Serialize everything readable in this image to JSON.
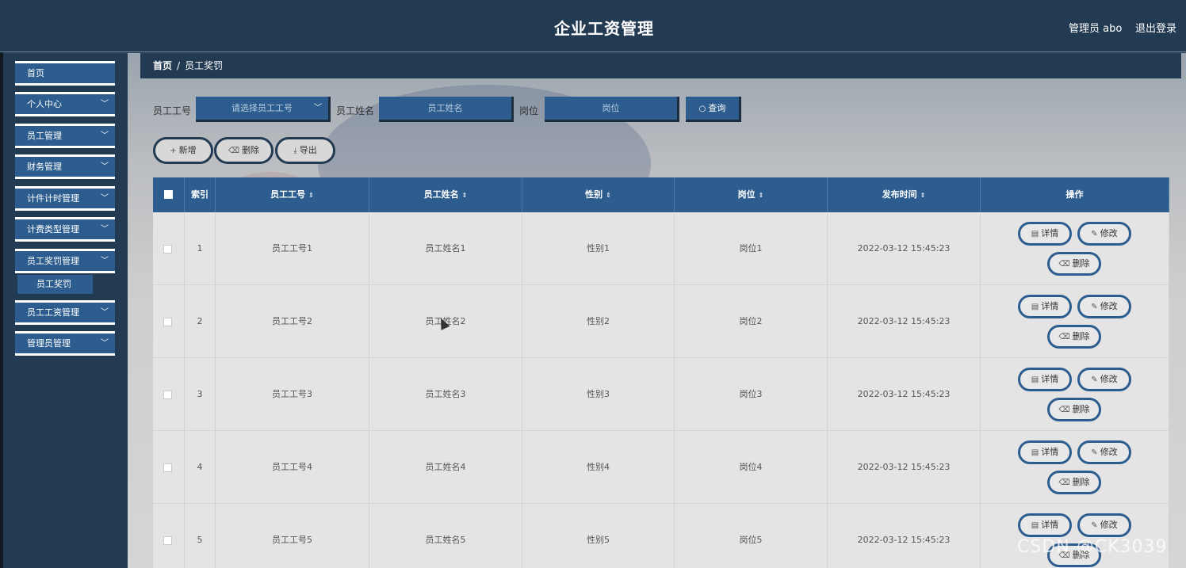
{
  "header": {
    "title": "企业工资管理",
    "admin_label": "管理员 abo",
    "logout_label": "退出登录"
  },
  "sidebar": {
    "items": [
      {
        "label": "首页",
        "has_chevron": false
      },
      {
        "label": "个人中心",
        "has_chevron": true
      },
      {
        "label": "员工管理",
        "has_chevron": true
      },
      {
        "label": "财务管理",
        "has_chevron": true
      },
      {
        "label": "计件计时管理",
        "has_chevron": true
      },
      {
        "label": "计费类型管理",
        "has_chevron": true
      },
      {
        "label": "员工奖罚管理",
        "has_chevron": true
      },
      {
        "label": "员工工资管理",
        "has_chevron": true
      },
      {
        "label": "管理员管理",
        "has_chevron": true
      }
    ],
    "active_sub": "员工奖罚",
    "chevron_glyph": "﹀"
  },
  "breadcrumb": {
    "home": "首页",
    "separator": "/",
    "current": "员工奖罚"
  },
  "filters": {
    "emp_no_label": "员工工号",
    "emp_no_placeholder": "请选择员工工号",
    "emp_name_label": "员工姓名",
    "emp_name_placeholder": "员工姓名",
    "position_label": "岗位",
    "position_placeholder": "岗位",
    "search_label": "查询"
  },
  "toolbar": {
    "add_label": "新增",
    "delete_label": "删除",
    "export_label": "导出"
  },
  "table": {
    "columns": [
      "索引",
      "员工工号",
      "员工姓名",
      "性别",
      "岗位",
      "发布时间",
      "操作"
    ],
    "rows": [
      {
        "index": "1",
        "emp_no": "员工工号1",
        "emp_name": "员工姓名1",
        "gender": "性别1",
        "position": "岗位1",
        "time": "2022-03-12 15:45:23"
      },
      {
        "index": "2",
        "emp_no": "员工工号2",
        "emp_name": "员工姓名2",
        "gender": "性别2",
        "position": "岗位2",
        "time": "2022-03-12 15:45:23"
      },
      {
        "index": "3",
        "emp_no": "员工工号3",
        "emp_name": "员工姓名3",
        "gender": "性别3",
        "position": "岗位3",
        "time": "2022-03-12 15:45:23"
      },
      {
        "index": "4",
        "emp_no": "员工工号4",
        "emp_name": "员工姓名4",
        "gender": "性别4",
        "position": "岗位4",
        "time": "2022-03-12 15:45:23"
      },
      {
        "index": "5",
        "emp_no": "员工工号5",
        "emp_name": "员工姓名5",
        "gender": "性别5",
        "position": "岗位5",
        "time": "2022-03-12 15:45:23"
      }
    ],
    "actions": {
      "detail_label": "详情",
      "edit_label": "修改",
      "delete_label": "删除"
    }
  },
  "watermark": "CSDN @CK3039",
  "colors": {
    "header_bg": "#223a52",
    "accent": "#2d5d8e"
  }
}
